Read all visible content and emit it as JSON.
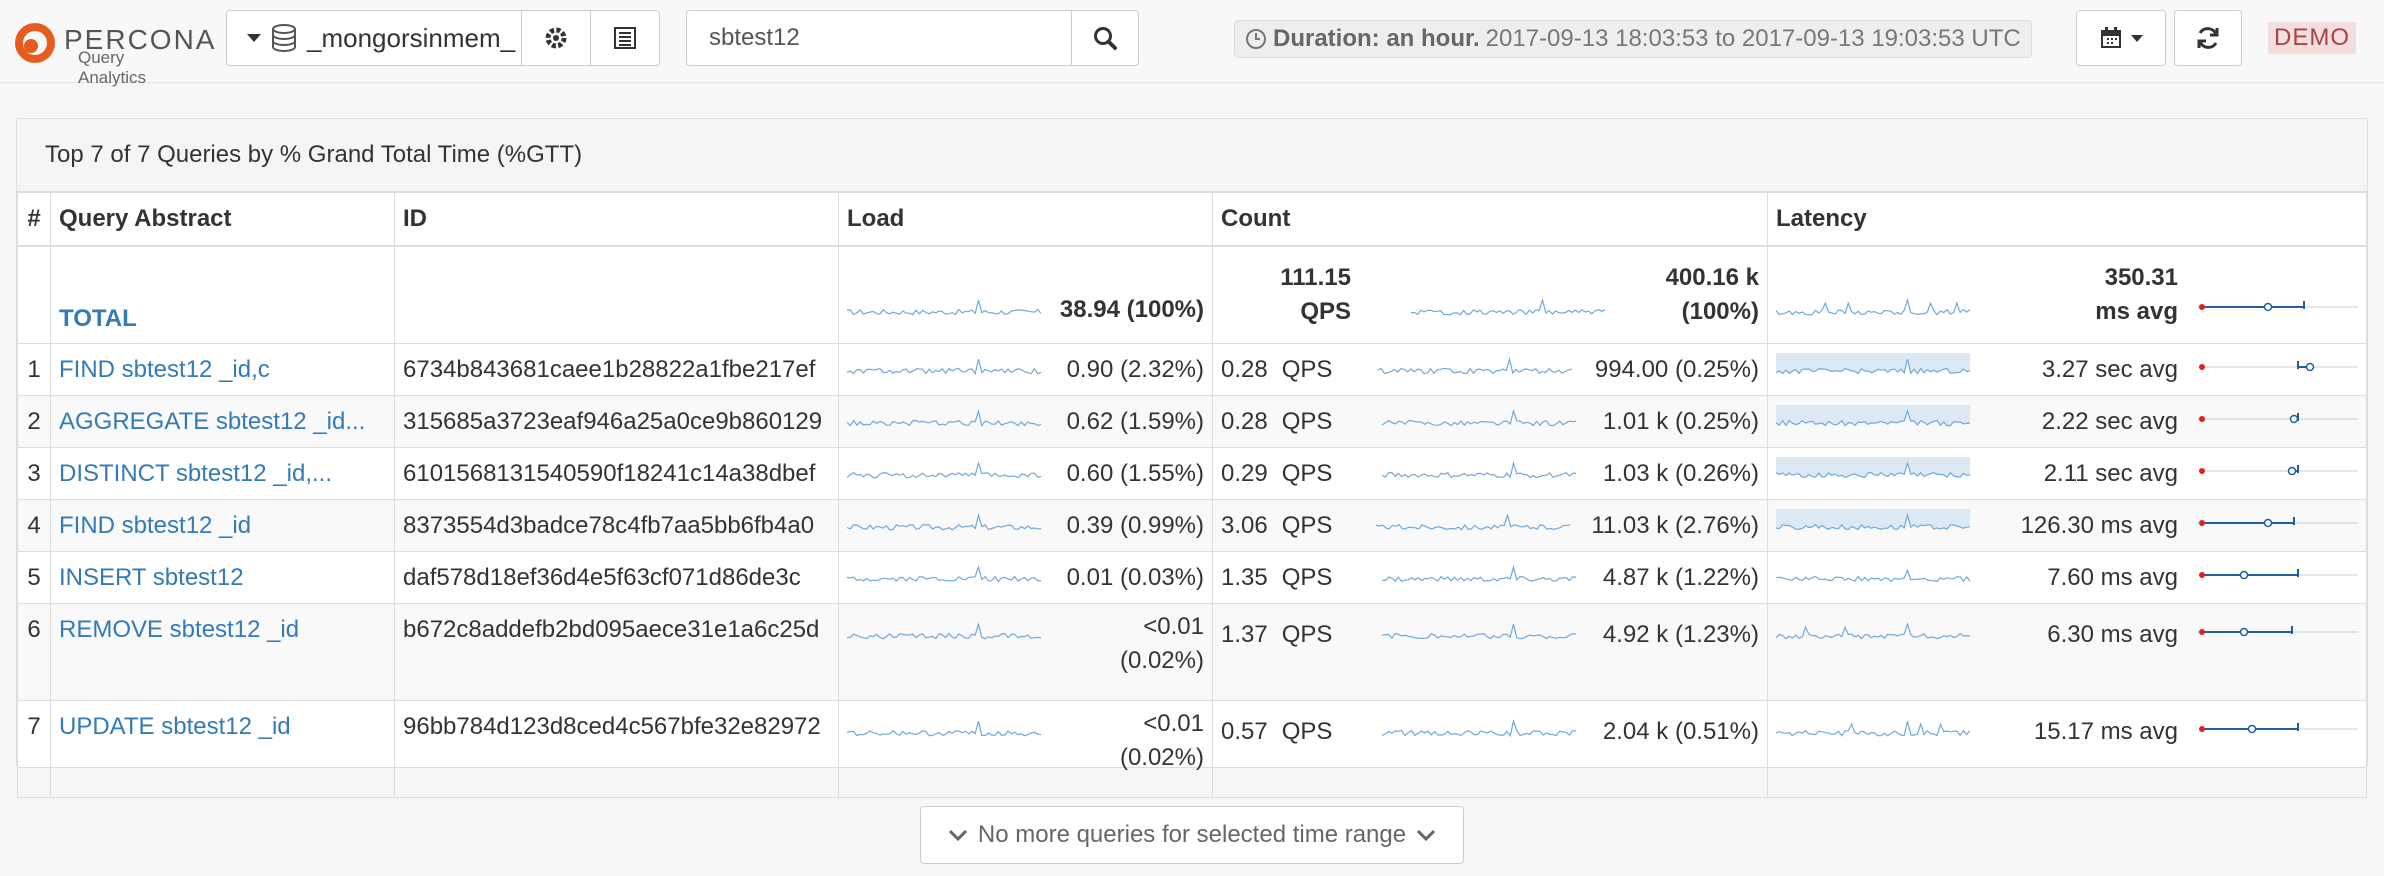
{
  "brand": {
    "name": "PERCONA",
    "product": "Query Analytics"
  },
  "toolbar": {
    "db_instance": "_mongorsinmem_",
    "search_value": "sbtest12",
    "duration_label": "Duration: an hour.",
    "duration_range": "2017-09-13 18:03:53 to 2017-09-13 19:03:53 UTC",
    "demo_badge": "DEMO"
  },
  "panel": {
    "heading": "Top 7 of 7 Queries by % Grand Total Time (%GTT)",
    "columns": {
      "num": "#",
      "abstract": "Query Abstract",
      "id": "ID",
      "load": "Load",
      "count": "Count",
      "latency": "Latency"
    },
    "total": {
      "label": "TOTAL",
      "load": "38.94 (100%)",
      "qps_value": "111.15",
      "qps_unit": "QPS",
      "count_value": "400.16 k",
      "count_pct": "(100%)",
      "latency_value": "350.31",
      "latency_unit": "ms avg"
    },
    "rows": [
      {
        "num": "1",
        "abstract": "FIND sbtest12 _id,c",
        "id": "6734b843681caee1b28822a1fbe217ef",
        "load": "0.90 (2.32%)",
        "qps": "0.28",
        "qps_unit": "QPS",
        "count": "994.00 (0.25%)",
        "latency": "3.27 sec avg"
      },
      {
        "num": "2",
        "abstract": "AGGREGATE sbtest12 _id...",
        "id": "315685a3723eaf946a25a0ce9b860129",
        "load": "0.62 (1.59%)",
        "qps": "0.28",
        "qps_unit": "QPS",
        "count": "1.01 k (0.25%)",
        "latency": "2.22 sec avg"
      },
      {
        "num": "3",
        "abstract": "DISTINCT sbtest12 _id,...",
        "id": "6101568131540590f18241c14a38dbef",
        "load": "0.60 (1.55%)",
        "qps": "0.29",
        "qps_unit": "QPS",
        "count": "1.03 k (0.26%)",
        "latency": "2.11 sec avg"
      },
      {
        "num": "4",
        "abstract": "FIND sbtest12 _id",
        "id": "8373554d3badce78c4fb7aa5bb6fb4a0",
        "load": "0.39 (0.99%)",
        "qps": "3.06",
        "qps_unit": "QPS",
        "count": "11.03 k (2.76%)",
        "latency": "126.30 ms avg"
      },
      {
        "num": "5",
        "abstract": "INSERT sbtest12",
        "id": "daf578d18ef36d4e5f63cf071d86de3c",
        "load": "0.01 (0.03%)",
        "qps": "1.35",
        "qps_unit": "QPS",
        "count": "4.87 k (1.22%)",
        "latency": "7.60 ms avg"
      },
      {
        "num": "6",
        "abstract": "REMOVE sbtest12 _id",
        "id": "b672c8addefb2bd095aece31e1a6c25d",
        "load_a": "<0.01",
        "load_b": "(0.02%)",
        "qps": "1.37",
        "qps_unit": "QPS",
        "count": "4.92 k (1.23%)",
        "latency": "6.30 ms avg"
      },
      {
        "num": "7",
        "abstract": "UPDATE sbtest12 _id",
        "id": "96bb784d123d8ced4c567bfe32e82972",
        "load_a": "<0.01",
        "load_b": "(0.02%)",
        "qps": "0.57",
        "qps_unit": "QPS",
        "count": "2.04 k (0.51%)",
        "latency": "15.17 ms avg"
      }
    ]
  },
  "footer": {
    "more_label": "No more queries for selected time range"
  },
  "colors": {
    "link": "#337ab7",
    "spark": "#6fa8dc",
    "latency_min": "#e02020",
    "latency_line": "#1f5fa0"
  }
}
